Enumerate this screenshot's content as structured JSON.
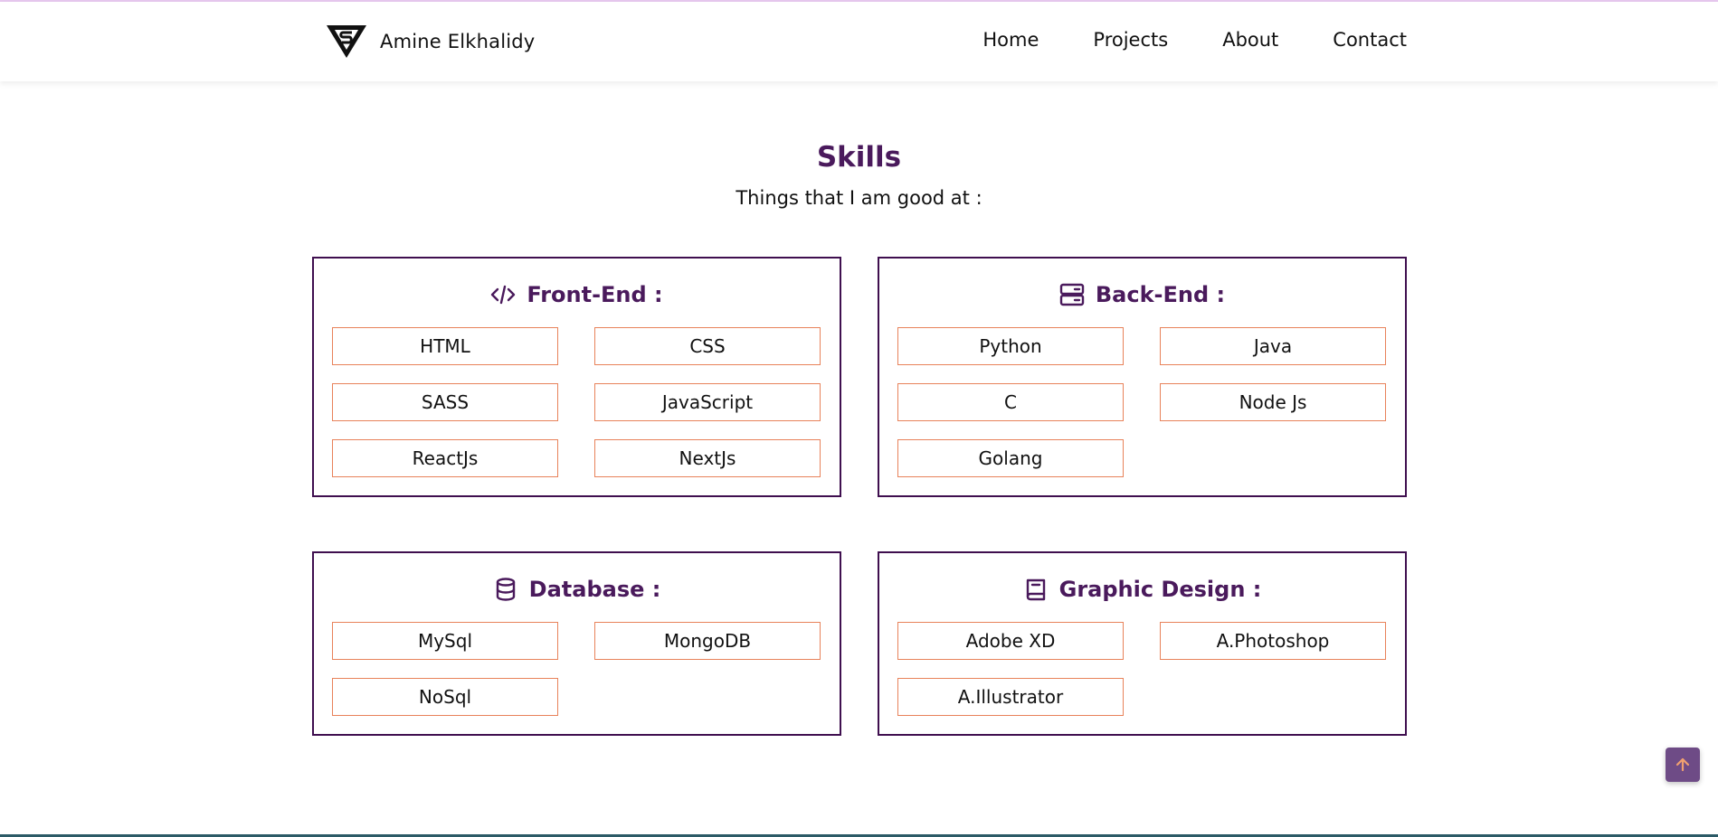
{
  "brand": {
    "name": "Amine Elkhalidy"
  },
  "nav": {
    "items": [
      "Home",
      "Projects",
      "About",
      "Contact"
    ]
  },
  "section": {
    "title": "Skills",
    "subtitle": "Things that I am good at :"
  },
  "cards": [
    {
      "icon": "code-icon",
      "title": "Front-End :",
      "skills": [
        "HTML",
        "CSS",
        "SASS",
        "JavaScript",
        "ReactJs",
        "NextJs"
      ]
    },
    {
      "icon": "server-icon",
      "title": "Back-End :",
      "skills": [
        "Python",
        "Java",
        "C",
        "Node Js",
        "Golang"
      ]
    },
    {
      "icon": "database-icon",
      "title": "Database :",
      "skills": [
        "MySql",
        "MongoDB",
        "NoSql"
      ]
    },
    {
      "icon": "book-icon",
      "title": "Graphic Design :",
      "skills": [
        "Adobe XD",
        "A.Photoshop",
        "A.Illustrator"
      ]
    }
  ],
  "colors": {
    "accent": "#4a1a5c",
    "chip_border": "#e8825a",
    "card_border": "#3f0f4f",
    "scroll_button": "#6e4b86"
  },
  "scroll_top": {
    "icon": "arrow-up-icon"
  }
}
